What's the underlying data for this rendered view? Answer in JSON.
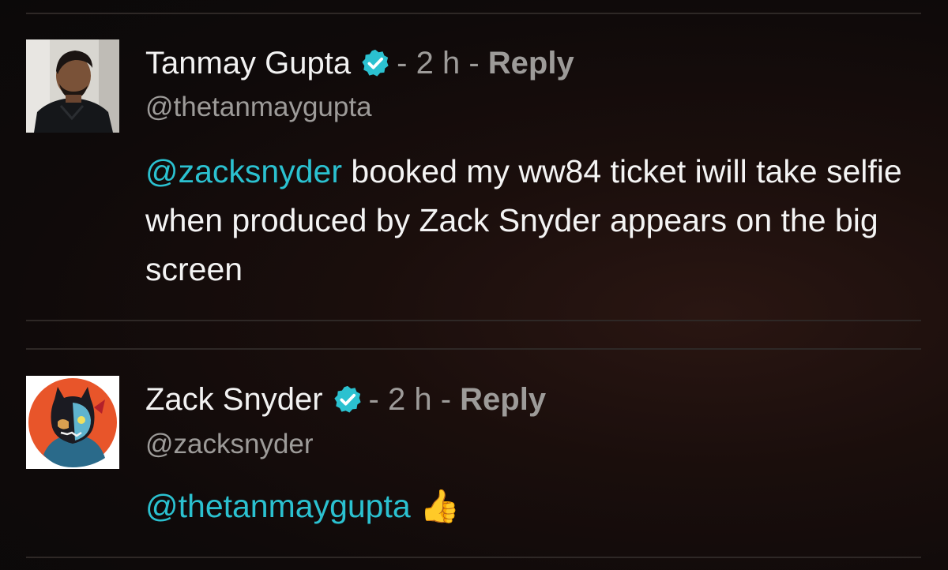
{
  "comments": [
    {
      "author": "Tanmay Gupta",
      "time": "2 h",
      "reply_label": "Reply",
      "handle": "@thetanmaygupta",
      "mention": "@zacksnyder",
      "text": "booked my ww84 ticket iwill take selfie when produced by Zack Snyder appears on the big screen",
      "avatar_icon": "profile-photo-man"
    },
    {
      "author": "Zack Snyder",
      "time": "2 h",
      "reply_label": "Reply",
      "handle": "@zacksnyder",
      "mention": "@thetanmaygupta",
      "text": "",
      "emoji": "👍",
      "avatar_icon": "profile-illustration-zombie-batman"
    }
  ],
  "separator": "-",
  "colors": {
    "mention": "#2bc1d0",
    "verified": "#2bc1d0",
    "meta": "#9d9b99",
    "background": "#0f0a0a"
  }
}
